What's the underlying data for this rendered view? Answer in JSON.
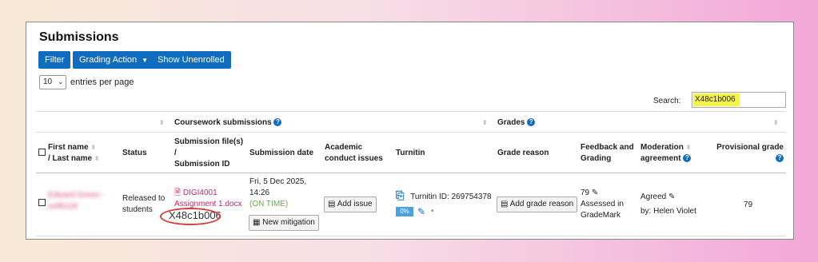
{
  "page": {
    "title": "Submissions"
  },
  "toolbar": {
    "filter_label": "Filter",
    "grading_action_label": "Grading Action",
    "show_unenrolled_label": "Show Unenrolled"
  },
  "entries": {
    "value": "10",
    "suffix": "entries per page"
  },
  "search": {
    "label": "Search:",
    "value": "X48c1b006"
  },
  "groups": {
    "coursework": "Coursework submissions",
    "grades": "Grades"
  },
  "columns": {
    "name_line1": "First name",
    "name_line2": "/ Last name",
    "status": "Status",
    "file_line1": "Submission file(s)",
    "file_line2": "/",
    "file_line3": "Submission ID",
    "date": "Submission date",
    "academic_line1": "Academic",
    "academic_line2": "conduct issues",
    "turnitin": "Turnitin",
    "grade_reason": "Grade reason",
    "feedback_line1": "Feedback and",
    "feedback_line2": "Grading",
    "moderation_line1": "Moderation",
    "moderation_line2": "agreement",
    "provisional": "Provisional grade"
  },
  "row": {
    "name_line1": "Edward Green -",
    "name_line2": "xx96118",
    "status_line1": "Released to",
    "status_line2": "students",
    "file_line1": "DIGI4001",
    "file_line2": "Assignment 1.docx",
    "submission_id": "X48c1b006",
    "date_line1": "Fri, 5 Dec 2025,",
    "date_line2": "14:26",
    "date_status": "(ON TIME)",
    "new_mitigation": "New mitigation",
    "add_issue": "Add issue",
    "turnitin_id": "Turnitin ID: 269754378",
    "turnitin_percent": "0%",
    "turnitin_dot": "•",
    "add_grade_reason": "Add grade reason",
    "feedback_grade": "79",
    "feedback_line2": "Assessed in",
    "feedback_line3": "GradeMark",
    "moderation_status": "Agreed",
    "moderation_by": "by: Helen Violet",
    "provisional_grade": "79"
  },
  "colors": {
    "accent": "#0f6cbf",
    "highlight": "#f5f34a",
    "annotation": "#d93b3b"
  }
}
